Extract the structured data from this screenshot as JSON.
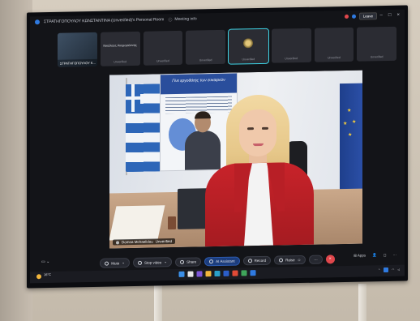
{
  "window": {
    "title": "ΣΤΡΑΤΗΓΟΠΟΥΛΟΥ ΚΩΝΣΤΑΝΤΙΝΑ (Unverified)'s Personal Room",
    "meeting_info": "Meeting info",
    "leave": "Leave"
  },
  "participants": [
    {
      "name": "ΣΤΡΑΤΗΓΟΠΟΥΛΟΥ Κ...",
      "tag": "",
      "self": true
    },
    {
      "name": "Νικόλαος Ανεμογιάννης",
      "tag": "Unverified"
    },
    {
      "name": "",
      "tag": "Unverified"
    },
    {
      "name": "",
      "tag": "Unverified"
    },
    {
      "name": "",
      "tag": "Unverified",
      "active": true,
      "logo": true
    },
    {
      "name": "",
      "tag": "Unverified"
    },
    {
      "name": "",
      "tag": "Unverified"
    },
    {
      "name": "",
      "tag": "Unverified"
    }
  ],
  "main_video": {
    "poster_text": "Γίνε εργοδότης των ευκαιριών",
    "speaker_name": "Domna Mchaelidou",
    "speaker_tag": "Unverified"
  },
  "controls": {
    "mute": "Mute",
    "stop_video": "Stop video",
    "share": "Share",
    "ai_assistant": "AI Assistant",
    "record": "Record",
    "raise": "Raise",
    "apps": "Apps",
    "end_icon": "close-icon"
  },
  "taskbar": {
    "temp": "16°C"
  },
  "colors": {
    "accent": "#2f7ae0",
    "end_call": "#e0474c",
    "active_tile": "#3fd4e6",
    "ai_button": "#1c3d7d"
  }
}
